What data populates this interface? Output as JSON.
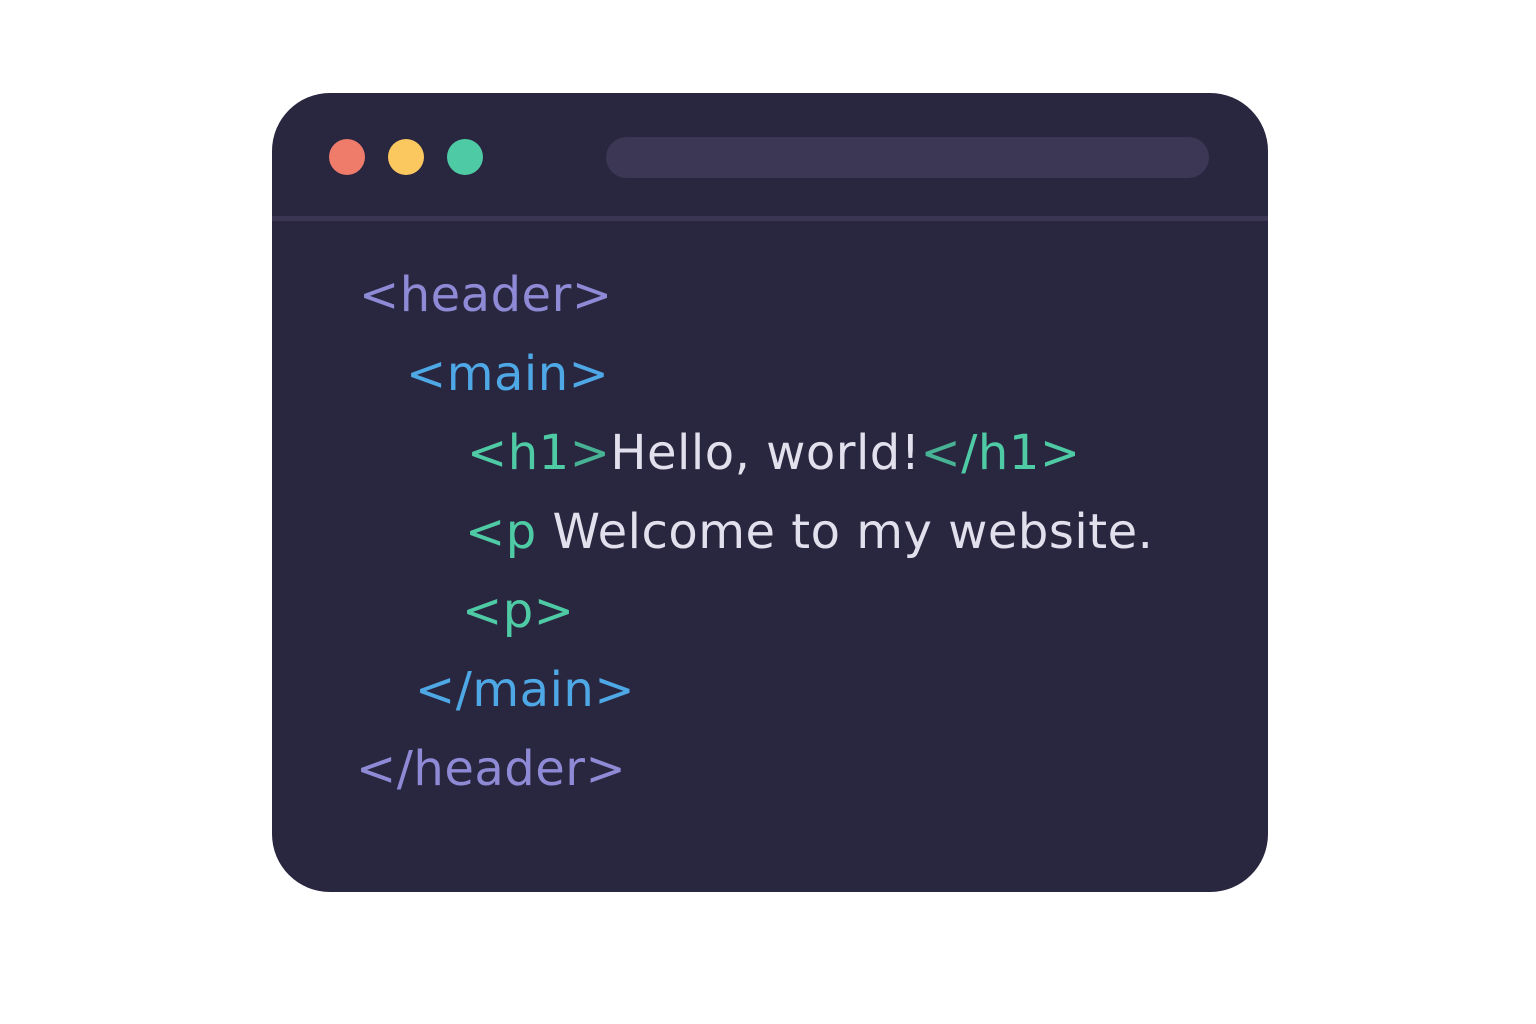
{
  "colors": {
    "window_bg": "#29263f",
    "address_bar": "#3b3755",
    "dot_red": "#ef7b6b",
    "dot_yellow": "#fbc75f",
    "dot_green": "#4ecba5",
    "header_tag": "#8f8ad6",
    "main_tag": "#4fa8e6",
    "h1_p_tag": "#4ecba5",
    "text": "#e3e0ee"
  },
  "code": {
    "line1": {
      "tag": "<header>"
    },
    "line2": {
      "tag": "<main>"
    },
    "line3": {
      "open": "<h1",
      "open_close": ">",
      "text": "Hello, world!",
      "close_lt": "<",
      "close": "/h1>"
    },
    "line4": {
      "tag": "<p",
      "text": "Welcome to my website."
    },
    "line5": {
      "tag": "<p>"
    },
    "line6": {
      "tag": "</main>"
    },
    "line7": {
      "tag": "</header>"
    }
  }
}
